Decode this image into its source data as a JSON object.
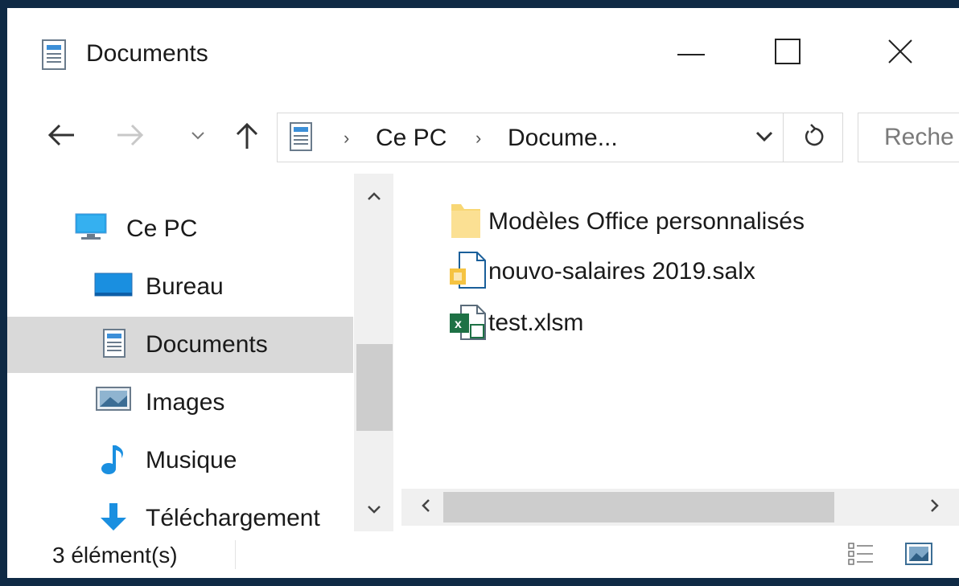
{
  "window": {
    "title": "Documents"
  },
  "title_buttons": {
    "minimize_icon": "minimize-icon",
    "maximize_icon": "maximize-icon",
    "close_icon": "close-icon"
  },
  "address_bar": {
    "crumbs": [
      "Ce PC",
      "Docume..."
    ],
    "search_placeholder": "Reche"
  },
  "nav_pane": {
    "items": [
      {
        "label": "Ce PC",
        "icon": "computer-icon"
      },
      {
        "label": "Bureau",
        "icon": "desktop-icon"
      },
      {
        "label": "Documents",
        "icon": "documents-icon",
        "selected": true
      },
      {
        "label": "Images",
        "icon": "images-icon"
      },
      {
        "label": "Musique",
        "icon": "music-icon"
      },
      {
        "label": "Téléchargement",
        "icon": "download-icon"
      }
    ]
  },
  "files": [
    {
      "name": "Modèles Office personnalisés",
      "icon": "folder-icon"
    },
    {
      "name": "nouvo-salaires 2019.salx",
      "icon": "salx-file-icon"
    },
    {
      "name": "test.xlsm",
      "icon": "excel-file-icon"
    }
  ],
  "status": {
    "count_text": "3 élément(s)"
  },
  "colors": {
    "frame": "#0f2a45",
    "selected": "#d9d9d9",
    "folder": "#f8d775",
    "excel": "#1e7145",
    "accent": "#0078d7"
  }
}
